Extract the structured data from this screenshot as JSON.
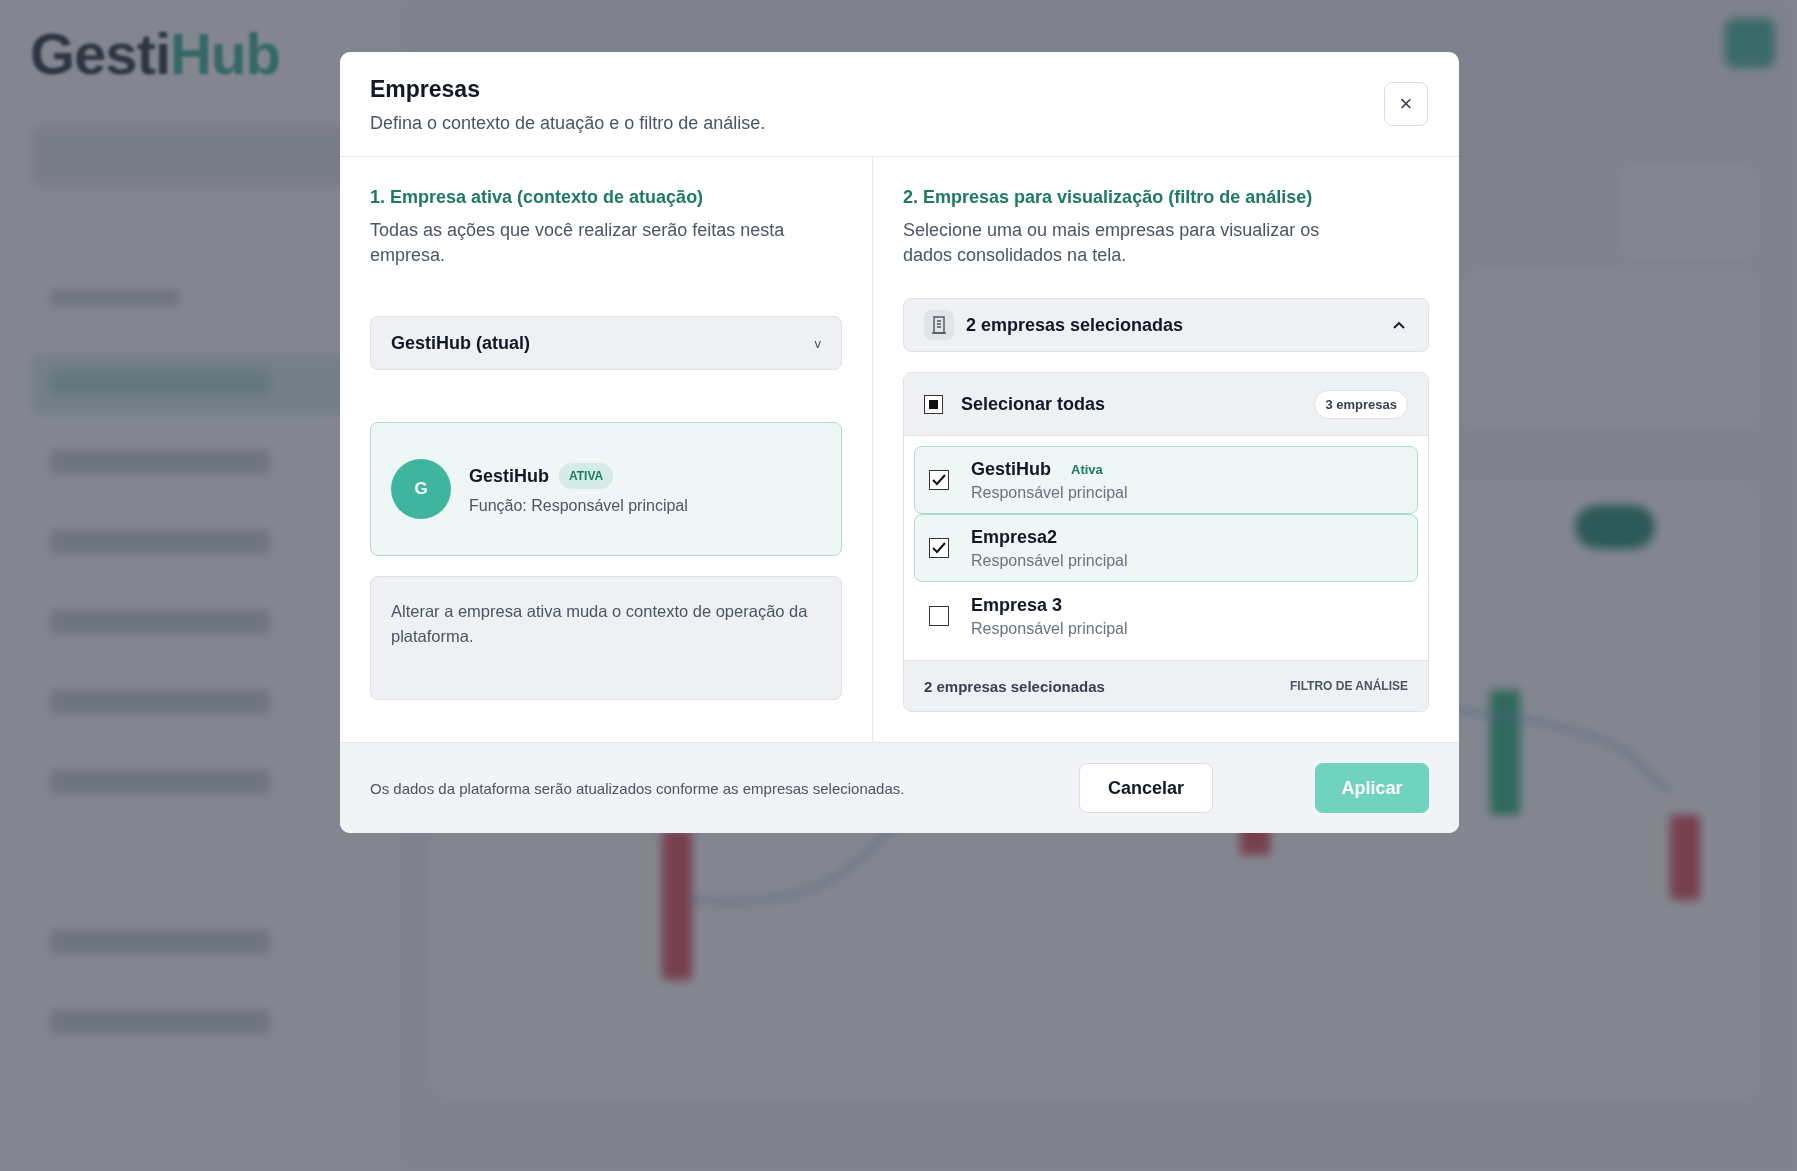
{
  "background": {
    "logo_prefix": "Gesti",
    "logo_suffix": "Hub"
  },
  "dialog": {
    "title": "Empresas",
    "subtitle": "Defina o contexto de atuação e o filtro de análise.",
    "close": "×",
    "active_section": {
      "heading": "1. Empresa ativa (contexto de atuação)",
      "description": "Todas as ações que você realizar serão feitas nesta empresa.",
      "select": {
        "value": "GestiHub (atual)",
        "caret": "v"
      },
      "card": {
        "initial": "G",
        "name": "GestiHub",
        "badge": "ATIVA",
        "role": "Função: Responsável principal"
      },
      "note": "Alterar a empresa ativa muda o contexto de operação da plataforma."
    },
    "view_section": {
      "heading": "2. Empresas para visualização (filtro de análise)",
      "description": "Selecione uma ou mais empresas para visualizar os dados consolidados na tela.",
      "dropdown": {
        "value": "2 empresas selecionadas",
        "expanded": true
      },
      "select_all": {
        "label": "Selecionar todas",
        "indeterminate": true,
        "count": "3 empresas"
      },
      "companies": [
        {
          "name": "GestiHub",
          "badge": "Ativa",
          "role": "Responsável principal",
          "checked": true
        },
        {
          "name": "Empresa2",
          "role": "Responsável principal",
          "checked": true
        },
        {
          "name": "Empresa 3",
          "role": "Responsável principal",
          "checked": false
        }
      ],
      "summary": "2 empresas selecionadas",
      "summary_tag": "FILTRO DE ANÁLISE"
    },
    "footer": {
      "note": "Os dados da plataforma serão atualizados conforme as empresas selecionadas.",
      "buttons": [
        {
          "label": "Cancelar",
          "kind": "secondary"
        },
        {
          "label": "Aplicar",
          "kind": "primary"
        }
      ]
    }
  }
}
